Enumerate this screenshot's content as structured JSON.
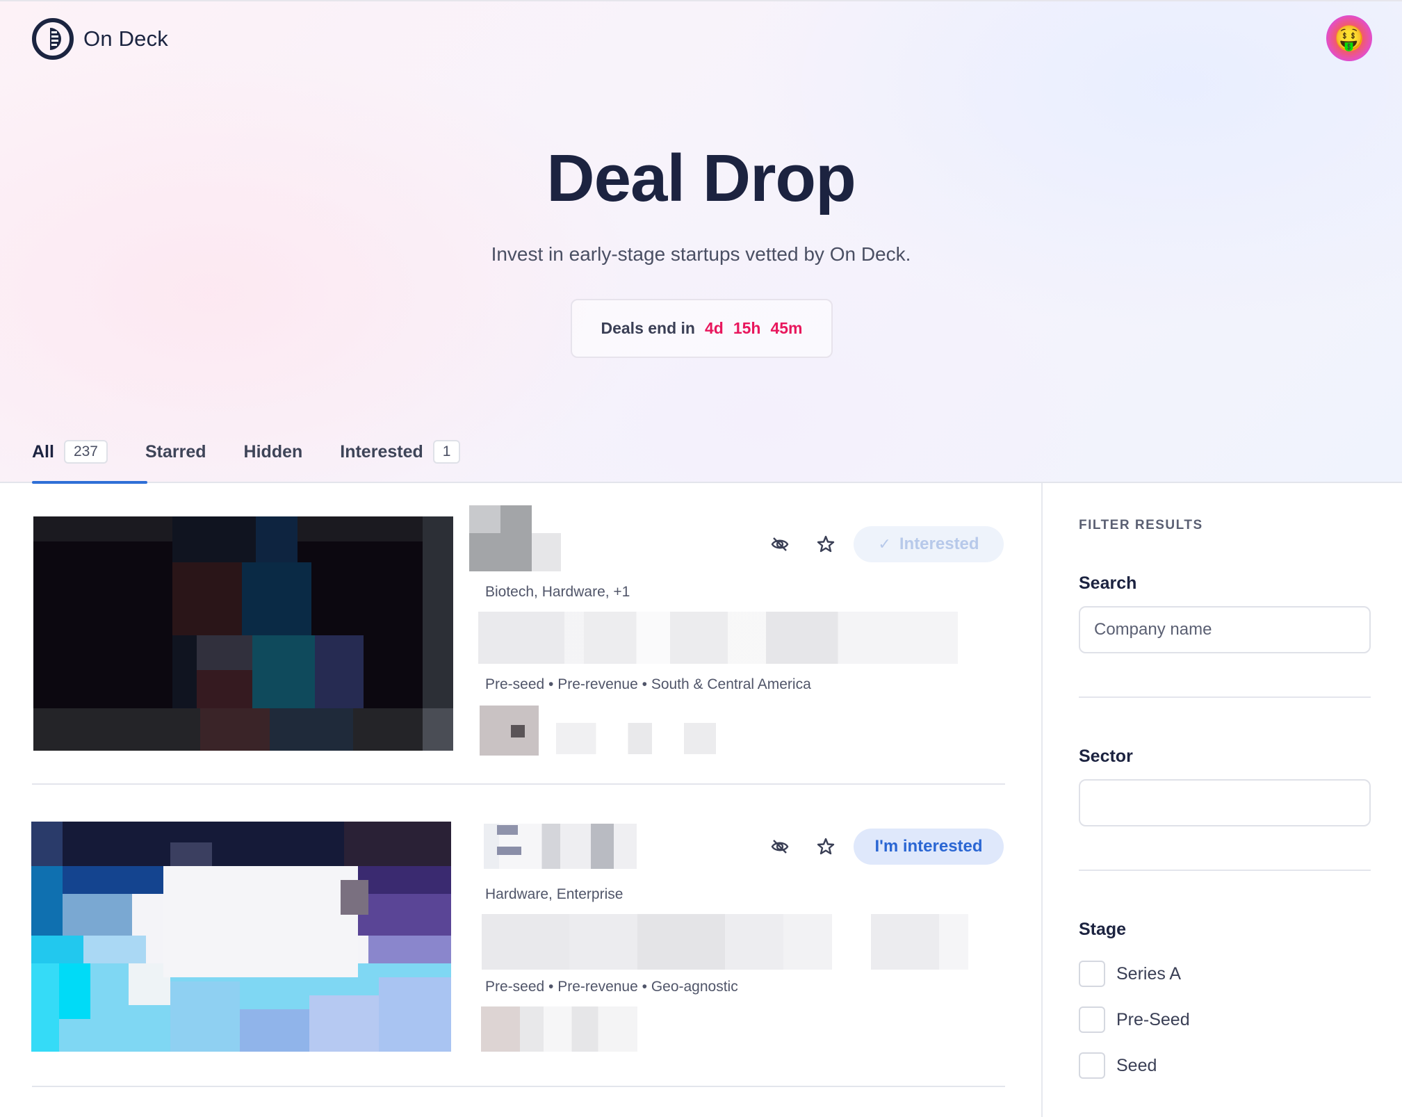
{
  "header": {
    "logo_text": "On Deck",
    "avatar_emoji": "🤑"
  },
  "hero": {
    "title": "Deal Drop",
    "subtitle": "Invest in early-stage startups vetted by On Deck.",
    "countdown_label": "Deals end in",
    "countdown_days": "4d",
    "countdown_hours": "15h",
    "countdown_minutes": "45m"
  },
  "tabs": [
    {
      "label": "All",
      "count": "237",
      "active": true
    },
    {
      "label": "Starred"
    },
    {
      "label": "Hidden"
    },
    {
      "label": "Interested",
      "count": "1"
    }
  ],
  "deals": [
    {
      "tags": "Biotech, Hardware, +1",
      "meta": "Pre-seed • Pre-revenue • South & Central America",
      "interest_label": "Interested",
      "interest_state": "interested"
    },
    {
      "tags": "Hardware, Enterprise",
      "meta": "Pre-seed • Pre-revenue • Geo-agnostic",
      "interest_label": "I'm interested",
      "interest_state": "not-interested"
    }
  ],
  "filters": {
    "heading": "FILTER RESULTS",
    "search_label": "Search",
    "search_placeholder": "Company name",
    "sector_label": "Sector",
    "sector_value": "",
    "stage_label": "Stage",
    "stages": [
      "Series A",
      "Pre-Seed",
      "Seed"
    ]
  },
  "colors": {
    "accent": "#2f6fd6",
    "countdown": "#e8175d",
    "navy": "#1c2340"
  }
}
